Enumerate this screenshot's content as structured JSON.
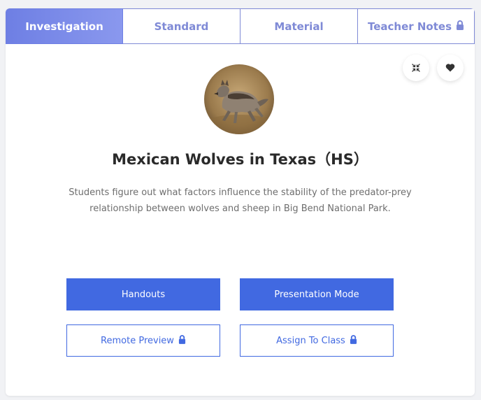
{
  "tabs": [
    {
      "label": "Investigation",
      "active": true,
      "locked": false
    },
    {
      "label": "Standard",
      "active": false,
      "locked": false
    },
    {
      "label": "Material",
      "active": false,
      "locked": false
    },
    {
      "label": "Teacher Notes",
      "active": false,
      "locked": true
    }
  ],
  "actions": {
    "collapse_icon": "compress-icon",
    "favorite_icon": "heart-icon"
  },
  "lesson": {
    "image_subject": "wolf",
    "title": "Mexican Wolves in Texas（HS）",
    "description": "Students figure out what factors influence the stability of the predator-prey relationship between wolves and sheep in Big Bend National Park."
  },
  "buttons": {
    "handouts": "Handouts",
    "presentation_mode": "Presentation Mode",
    "remote_preview": "Remote Preview",
    "assign_to_class": "Assign To Class"
  },
  "colors": {
    "accent": "#4169e1",
    "tab_accent": "#7f8ad6",
    "tab_active_start": "#6e7fe4",
    "tab_active_end": "#8a98ee"
  }
}
